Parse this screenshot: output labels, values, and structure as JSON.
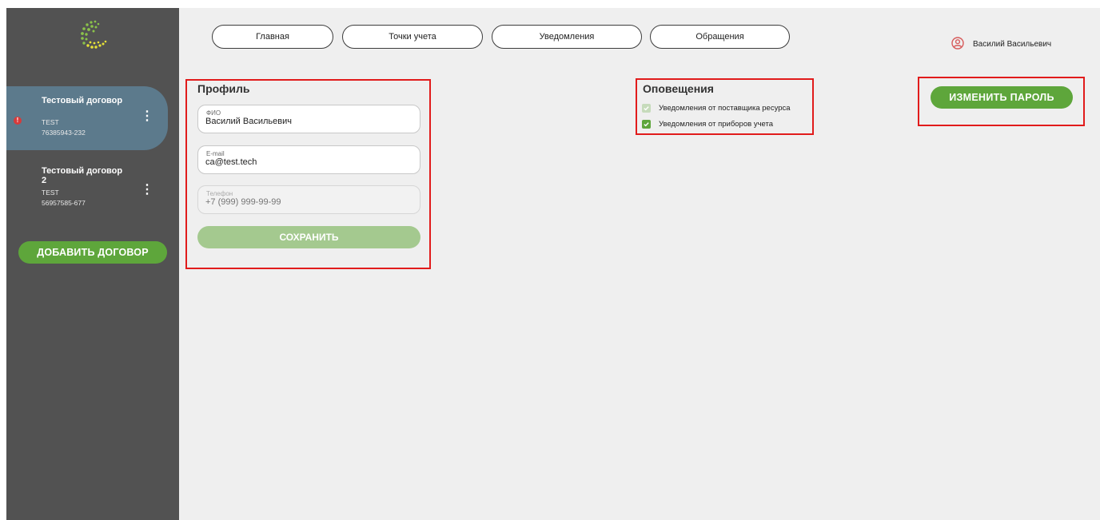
{
  "sidebar": {
    "contracts": [
      {
        "name": "Тестовый договор",
        "code": "TEST",
        "number": "76385943-232",
        "menu": "⋮",
        "alert": "!"
      },
      {
        "name": "Тестовый договор 2",
        "code": "TEST",
        "number": "56957585-677",
        "menu": "⋮"
      }
    ],
    "add_button": "ДОБАВИТЬ ДОГОВОР"
  },
  "nav": {
    "items": [
      "Главная",
      "Точки учета",
      "Уведомления",
      "Обращения"
    ]
  },
  "user": {
    "name": "Василий Васильевич",
    "icon": "user-circle-icon"
  },
  "profile": {
    "title": "Профиль",
    "fio_label": "ФИО",
    "fio_value": "Василий Васильевич",
    "email_label": "E-mail",
    "email_value": "ca@test.tech",
    "phone_label": "Телефон",
    "phone_placeholder": "+7 (999) 999-99-99",
    "save_button": "СОХРАНИТЬ"
  },
  "notifications": {
    "title": "Оповещения",
    "options": [
      {
        "label": "Уведомления от поставщика ресурса",
        "checked": true,
        "disabled": true
      },
      {
        "label": "Уведомления от приборов учета",
        "checked": true,
        "disabled": false
      }
    ]
  },
  "change_password_button": "ИЗМЕНИТЬ ПАРОЛЬ",
  "colors": {
    "accent": "#5ea63b",
    "sidebar": "#525252",
    "active_item": "#5c7a8c",
    "highlight": "#e11b1b"
  }
}
